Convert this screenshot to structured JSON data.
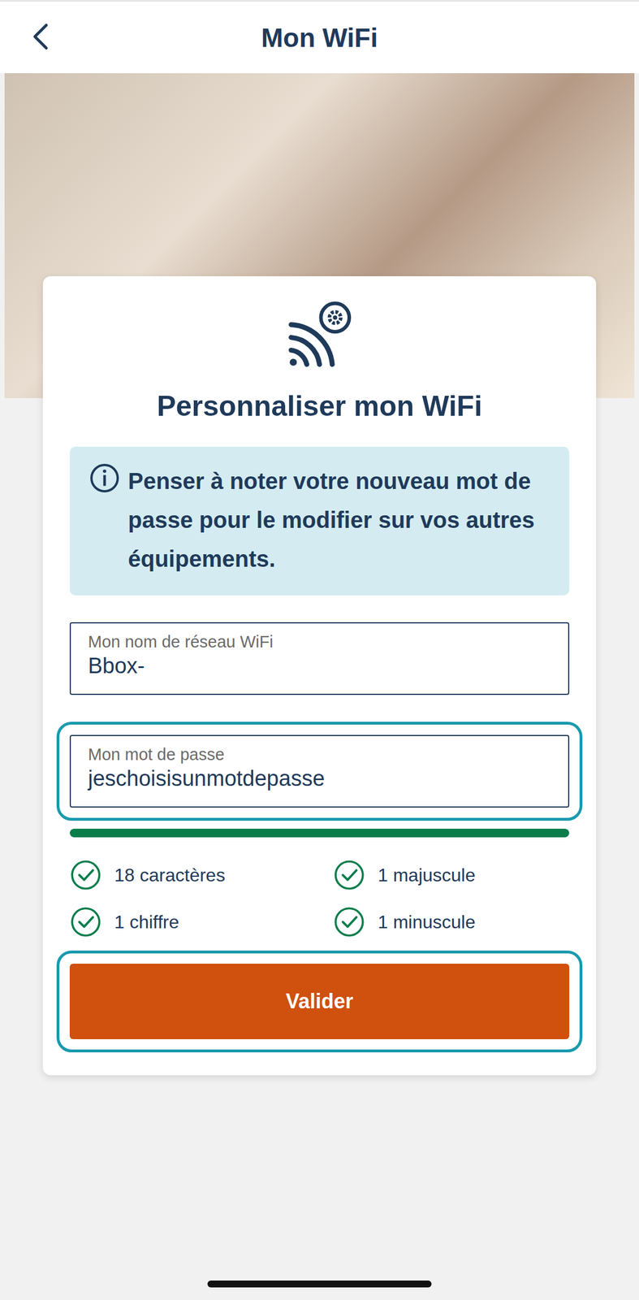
{
  "header": {
    "title": "Mon WiFi"
  },
  "card": {
    "title": "Personnaliser mon WiFi",
    "info": "Penser à noter votre nouveau mot de passe pour le modifier sur vos autres équipements.",
    "fields": [
      {
        "label": "Mon nom de réseau WiFi",
        "value": "Bbox-",
        "highlighted": false
      },
      {
        "label": "Mon mot de passe",
        "value": "jeschoisisunmotdepasse",
        "highlighted": true
      }
    ],
    "strength": {
      "level": 1,
      "color": "#0a7d4b"
    },
    "criteria": [
      {
        "label": "18 caractères",
        "checked": true
      },
      {
        "label": "1 majuscule",
        "checked": true
      },
      {
        "label": "1 chiffre",
        "checked": true
      },
      {
        "label": "1 minuscule",
        "checked": true
      }
    ],
    "button": {
      "label": "Valider",
      "highlighted": true
    }
  }
}
